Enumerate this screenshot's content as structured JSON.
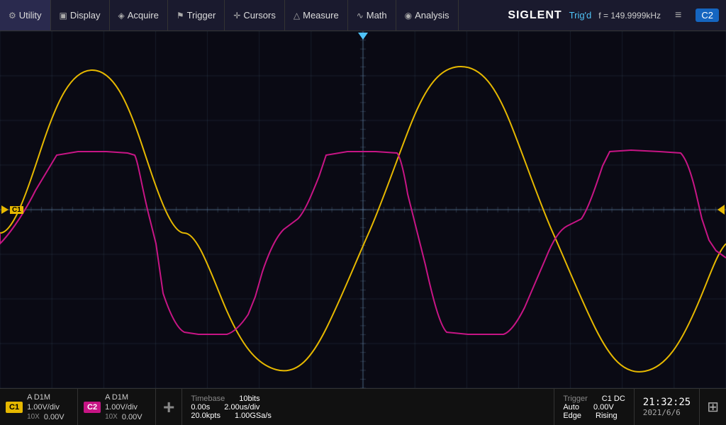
{
  "brand": "SIGLENT",
  "trig_status": "Trig'd",
  "freq_label": "f =",
  "freq_value": "149.9999kHz",
  "channel_active": "C2",
  "menu": [
    {
      "id": "utility",
      "icon": "⚙",
      "label": "Utility"
    },
    {
      "id": "display",
      "icon": "▣",
      "label": "Display"
    },
    {
      "id": "acquire",
      "icon": "◈",
      "label": "Acquire"
    },
    {
      "id": "trigger",
      "icon": "⚑",
      "label": "Trigger"
    },
    {
      "id": "cursors",
      "icon": "✛",
      "label": "Cursors"
    },
    {
      "id": "measure",
      "icon": "△",
      "label": "Measure"
    },
    {
      "id": "math",
      "icon": "∿",
      "label": "Math"
    },
    {
      "id": "analysis",
      "icon": "◉",
      "label": "Analysis"
    }
  ],
  "ch1": {
    "label": "C1",
    "coupling": "A D1M",
    "volts_div": "1.00V/div",
    "offset": "0.00V",
    "probe": "10X"
  },
  "ch2": {
    "label": "C2",
    "coupling": "A D1M",
    "volts_div": "1.00V/div",
    "offset": "0.00V",
    "probe": "10X"
  },
  "timebase": {
    "label": "Timebase",
    "bits": "10bits",
    "delay": "0.00s",
    "time_div": "2.00us/div",
    "kpts": "20.0kpts",
    "sample_rate": "1.00GSa/s"
  },
  "trigger": {
    "label": "Trigger",
    "source": "C1 DC",
    "level_label": "Auto",
    "level_value": "0.00V",
    "mode_label": "Edge",
    "mode_value": "Rising"
  },
  "time": "21:32:25",
  "date": "2021/6/6",
  "math_symbol": "+"
}
